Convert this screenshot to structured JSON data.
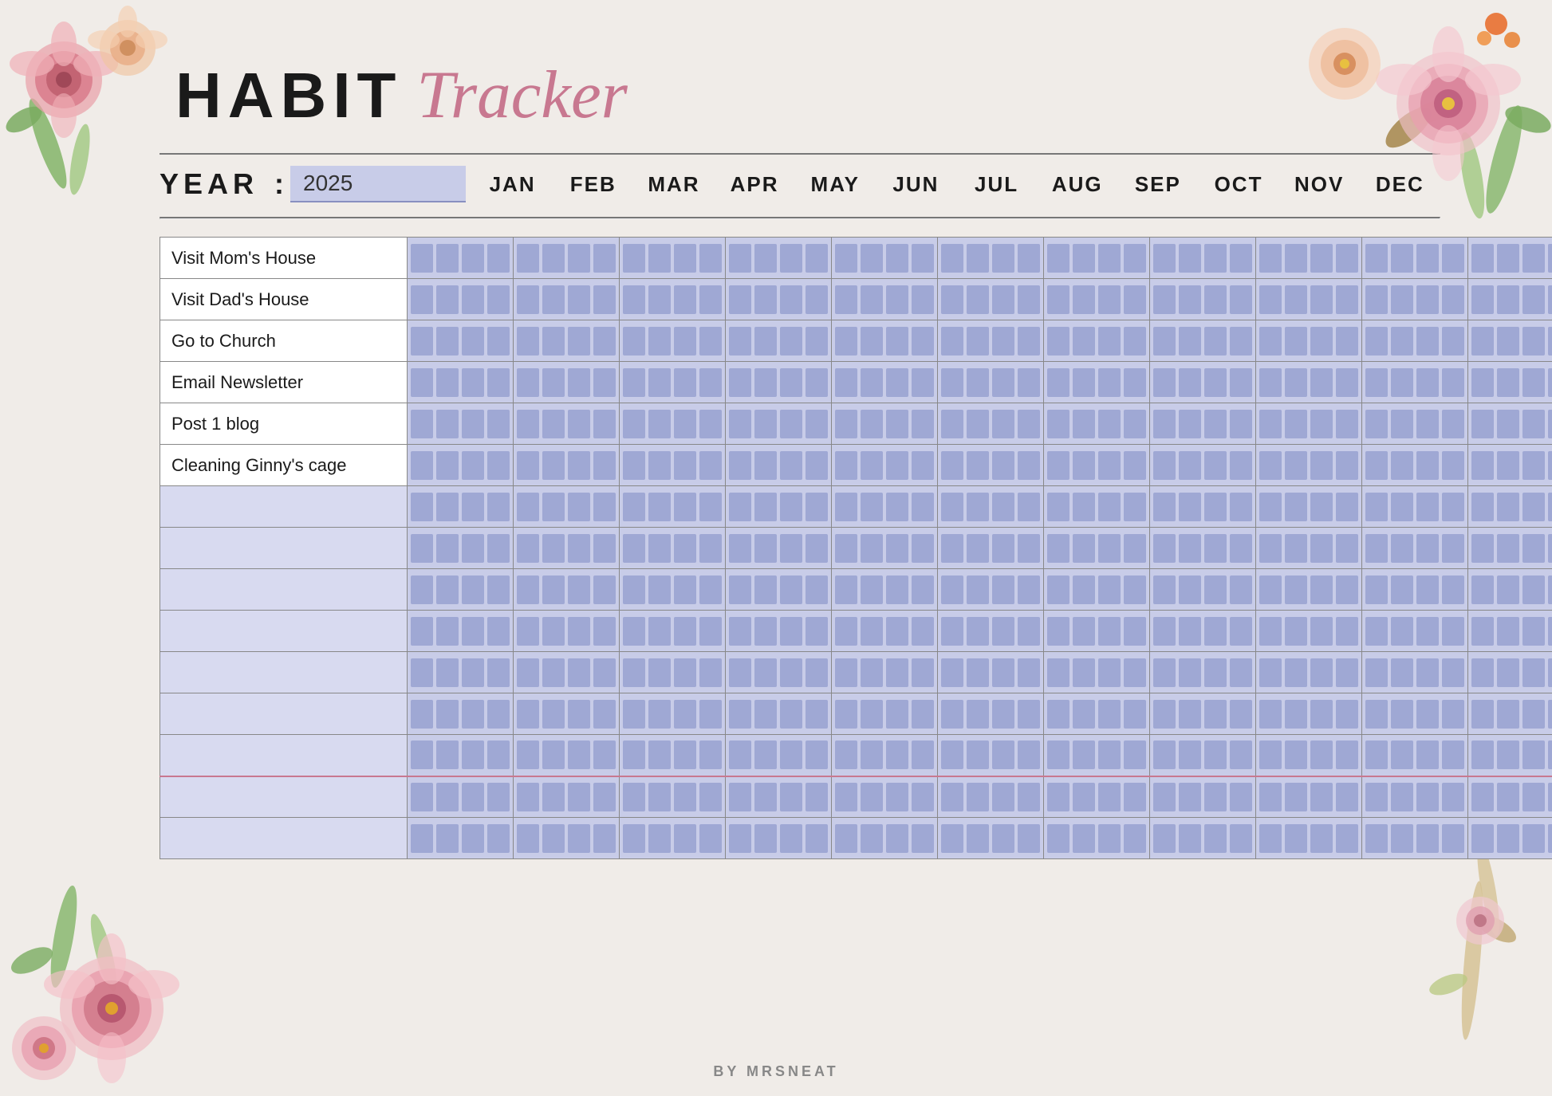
{
  "title": {
    "habit": "HABIT",
    "tracker": "Tracker"
  },
  "year_label": "YEAR",
  "year_colon": ":",
  "year_value": "2025",
  "months": [
    "JAN",
    "FEB",
    "MAR",
    "APR",
    "MAY",
    "JUN",
    "JUL",
    "AUG",
    "SEP",
    "OCT",
    "NOV",
    "DEC"
  ],
  "habits": [
    "Visit Mom's House",
    "Visit Dad's House",
    "Go to Church",
    "Email Newsletter",
    "Post 1 blog",
    "Cleaning Ginny's cage",
    "",
    "",
    "",
    "",
    "",
    "",
    "",
    "",
    ""
  ],
  "footer": "BY MRSNEAT",
  "colors": {
    "cell_bg": "#c8cce8",
    "check_box": "#9fa8d4",
    "habit_bg": "#ffffff",
    "empty_row": "#d8daf0",
    "accent": "#c87890"
  }
}
